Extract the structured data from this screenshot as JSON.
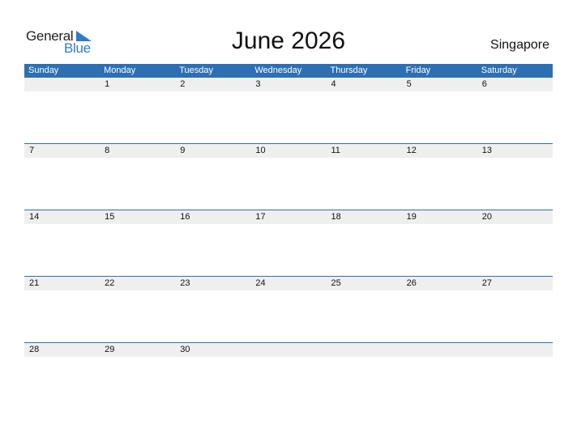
{
  "logo": {
    "word1": "General",
    "word2": "Blue"
  },
  "title": "June 2026",
  "country": "Singapore",
  "colors": {
    "header": "#2e6fb3",
    "accent": "#2e7dcb",
    "strip": "#efefef"
  },
  "weekdays": [
    "Sunday",
    "Monday",
    "Tuesday",
    "Wednesday",
    "Thursday",
    "Friday",
    "Saturday"
  ],
  "weeks": [
    [
      "",
      "1",
      "2",
      "3",
      "4",
      "5",
      "6"
    ],
    [
      "7",
      "8",
      "9",
      "10",
      "11",
      "12",
      "13"
    ],
    [
      "14",
      "15",
      "16",
      "17",
      "18",
      "19",
      "20"
    ],
    [
      "21",
      "22",
      "23",
      "24",
      "25",
      "26",
      "27"
    ],
    [
      "28",
      "29",
      "30",
      "",
      "",
      "",
      ""
    ]
  ]
}
